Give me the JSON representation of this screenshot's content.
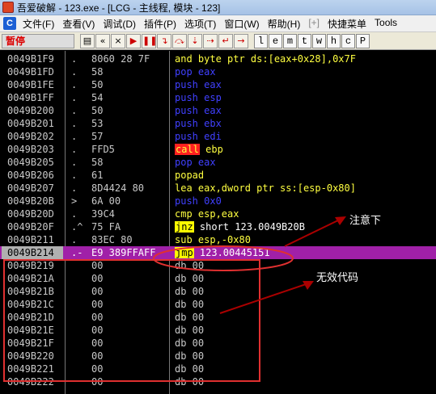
{
  "window": {
    "title": "吾爱破解 - 123.exe - [LCG - 主线程, 模块 - 123]"
  },
  "menu": {
    "items": [
      {
        "label": "文件(F)"
      },
      {
        "label": "查看(V)"
      },
      {
        "label": "调试(D)"
      },
      {
        "label": "插件(P)"
      },
      {
        "label": "选项(T)"
      },
      {
        "label": "窗口(W)"
      },
      {
        "label": "帮助(H)"
      },
      {
        "label": "[+]"
      },
      {
        "label": "快捷菜单"
      },
      {
        "label": "Tools"
      }
    ]
  },
  "toolbar": {
    "status": "暂停",
    "buttons": [
      {
        "icon": "open-icon",
        "glyph": "▤"
      },
      {
        "icon": "rewind-icon",
        "glyph": "«"
      },
      {
        "icon": "close-icon",
        "glyph": "×"
      },
      {
        "icon": "run-icon",
        "glyph": "▶"
      },
      {
        "icon": "pause-icon",
        "glyph": "❚❚"
      },
      {
        "icon": "step-into-icon",
        "glyph": "↴"
      },
      {
        "icon": "step-over-icon",
        "glyph": "⤼"
      },
      {
        "icon": "trace-into-icon",
        "glyph": "⇣"
      },
      {
        "icon": "trace-over-icon",
        "glyph": "⇢"
      },
      {
        "icon": "execute-till-return-icon",
        "glyph": "↵"
      },
      {
        "icon": "goto-icon",
        "glyph": "→"
      }
    ],
    "letters": [
      "l",
      "e",
      "m",
      "t",
      "w",
      "h",
      "c",
      "P"
    ]
  },
  "colors": {
    "selected_row": "#a020a8",
    "call_bg": "#ff2020",
    "jump_bg": "#ffff00",
    "keyword_yellow": "#ffff40",
    "stack_blue": "#4040ff",
    "annotation_red": "#e03030"
  },
  "disasm": {
    "rows": [
      {
        "addr": "0049B1F9",
        "mark": ".",
        "hex": "8060 28 7F",
        "mn": "and",
        "ops": " byte ptr ds:[eax+0x28],0x7F",
        "kind": "plain"
      },
      {
        "addr": "0049B1FD",
        "mark": ".",
        "hex": "58",
        "mn": "pop",
        "ops": " eax",
        "kind": "stack"
      },
      {
        "addr": "0049B1FE",
        "mark": ".",
        "hex": "50",
        "mn": "push",
        "ops": " eax",
        "kind": "stack"
      },
      {
        "addr": "0049B1FF",
        "mark": ".",
        "hex": "54",
        "mn": "push",
        "ops": " esp",
        "kind": "stack"
      },
      {
        "addr": "0049B200",
        "mark": ".",
        "hex": "50",
        "mn": "push",
        "ops": " eax",
        "kind": "stack"
      },
      {
        "addr": "0049B201",
        "mark": ".",
        "hex": "53",
        "mn": "push",
        "ops": " ebx",
        "kind": "stack"
      },
      {
        "addr": "0049B202",
        "mark": ".",
        "hex": "57",
        "mn": "push",
        "ops": " edi",
        "kind": "stack"
      },
      {
        "addr": "0049B203",
        "mark": ".",
        "hex": "FFD5",
        "mn": "call",
        "ops": " ebp",
        "kind": "call"
      },
      {
        "addr": "0049B205",
        "mark": ".",
        "hex": "58",
        "mn": "pop",
        "ops": " eax",
        "kind": "stack"
      },
      {
        "addr": "0049B206",
        "mark": ".",
        "hex": "61",
        "mn": "popad",
        "ops": "",
        "kind": "plain"
      },
      {
        "addr": "0049B207",
        "mark": ".",
        "hex": "8D4424 80",
        "mn": "lea",
        "ops": " eax,dword ptr ss:[esp-0x80]",
        "kind": "plain"
      },
      {
        "addr": "0049B20B",
        "mark": ">",
        "hex": "6A 00",
        "mn": "push",
        "ops": " 0x0",
        "kind": "stack"
      },
      {
        "addr": "0049B20D",
        "mark": ".",
        "hex": "39C4",
        "mn": "cmp",
        "ops": " esp,eax",
        "kind": "plain"
      },
      {
        "addr": "0049B20F",
        "mark": ".^",
        "hex": "75 FA",
        "mn": "jnz",
        "ops": " short 123.0049B20B",
        "kind": "jump"
      },
      {
        "addr": "0049B211",
        "mark": ".",
        "hex": "83EC 80",
        "mn": "sub",
        "ops": " esp,-0x80",
        "kind": "plain"
      },
      {
        "addr": "0049B214",
        "mark": ".-",
        "hex": "E9 389FFAFF",
        "mn": "jmp",
        "ops": " 123.00445151",
        "kind": "jump",
        "selected": true
      },
      {
        "addr": "0049B219",
        "mark": "",
        "hex": "00",
        "mn": "db",
        "ops": " 00",
        "kind": "data"
      },
      {
        "addr": "0049B21A",
        "mark": "",
        "hex": "00",
        "mn": "db",
        "ops": " 00",
        "kind": "data"
      },
      {
        "addr": "0049B21B",
        "mark": "",
        "hex": "00",
        "mn": "db",
        "ops": " 00",
        "kind": "data"
      },
      {
        "addr": "0049B21C",
        "mark": "",
        "hex": "00",
        "mn": "db",
        "ops": " 00",
        "kind": "data"
      },
      {
        "addr": "0049B21D",
        "mark": "",
        "hex": "00",
        "mn": "db",
        "ops": " 00",
        "kind": "data"
      },
      {
        "addr": "0049B21E",
        "mark": "",
        "hex": "00",
        "mn": "db",
        "ops": " 00",
        "kind": "data"
      },
      {
        "addr": "0049B21F",
        "mark": "",
        "hex": "00",
        "mn": "db",
        "ops": " 00",
        "kind": "data"
      },
      {
        "addr": "0049B220",
        "mark": "",
        "hex": "00",
        "mn": "db",
        "ops": " 00",
        "kind": "data"
      },
      {
        "addr": "0049B221",
        "mark": "",
        "hex": "00",
        "mn": "db",
        "ops": " 00",
        "kind": "data"
      },
      {
        "addr": "0049B222",
        "mark": "",
        "hex": "00",
        "mn": "db",
        "ops": " 00",
        "kind": "data"
      }
    ]
  },
  "annotations": {
    "note_jump": "注意下",
    "note_invalid": "无效代码"
  }
}
